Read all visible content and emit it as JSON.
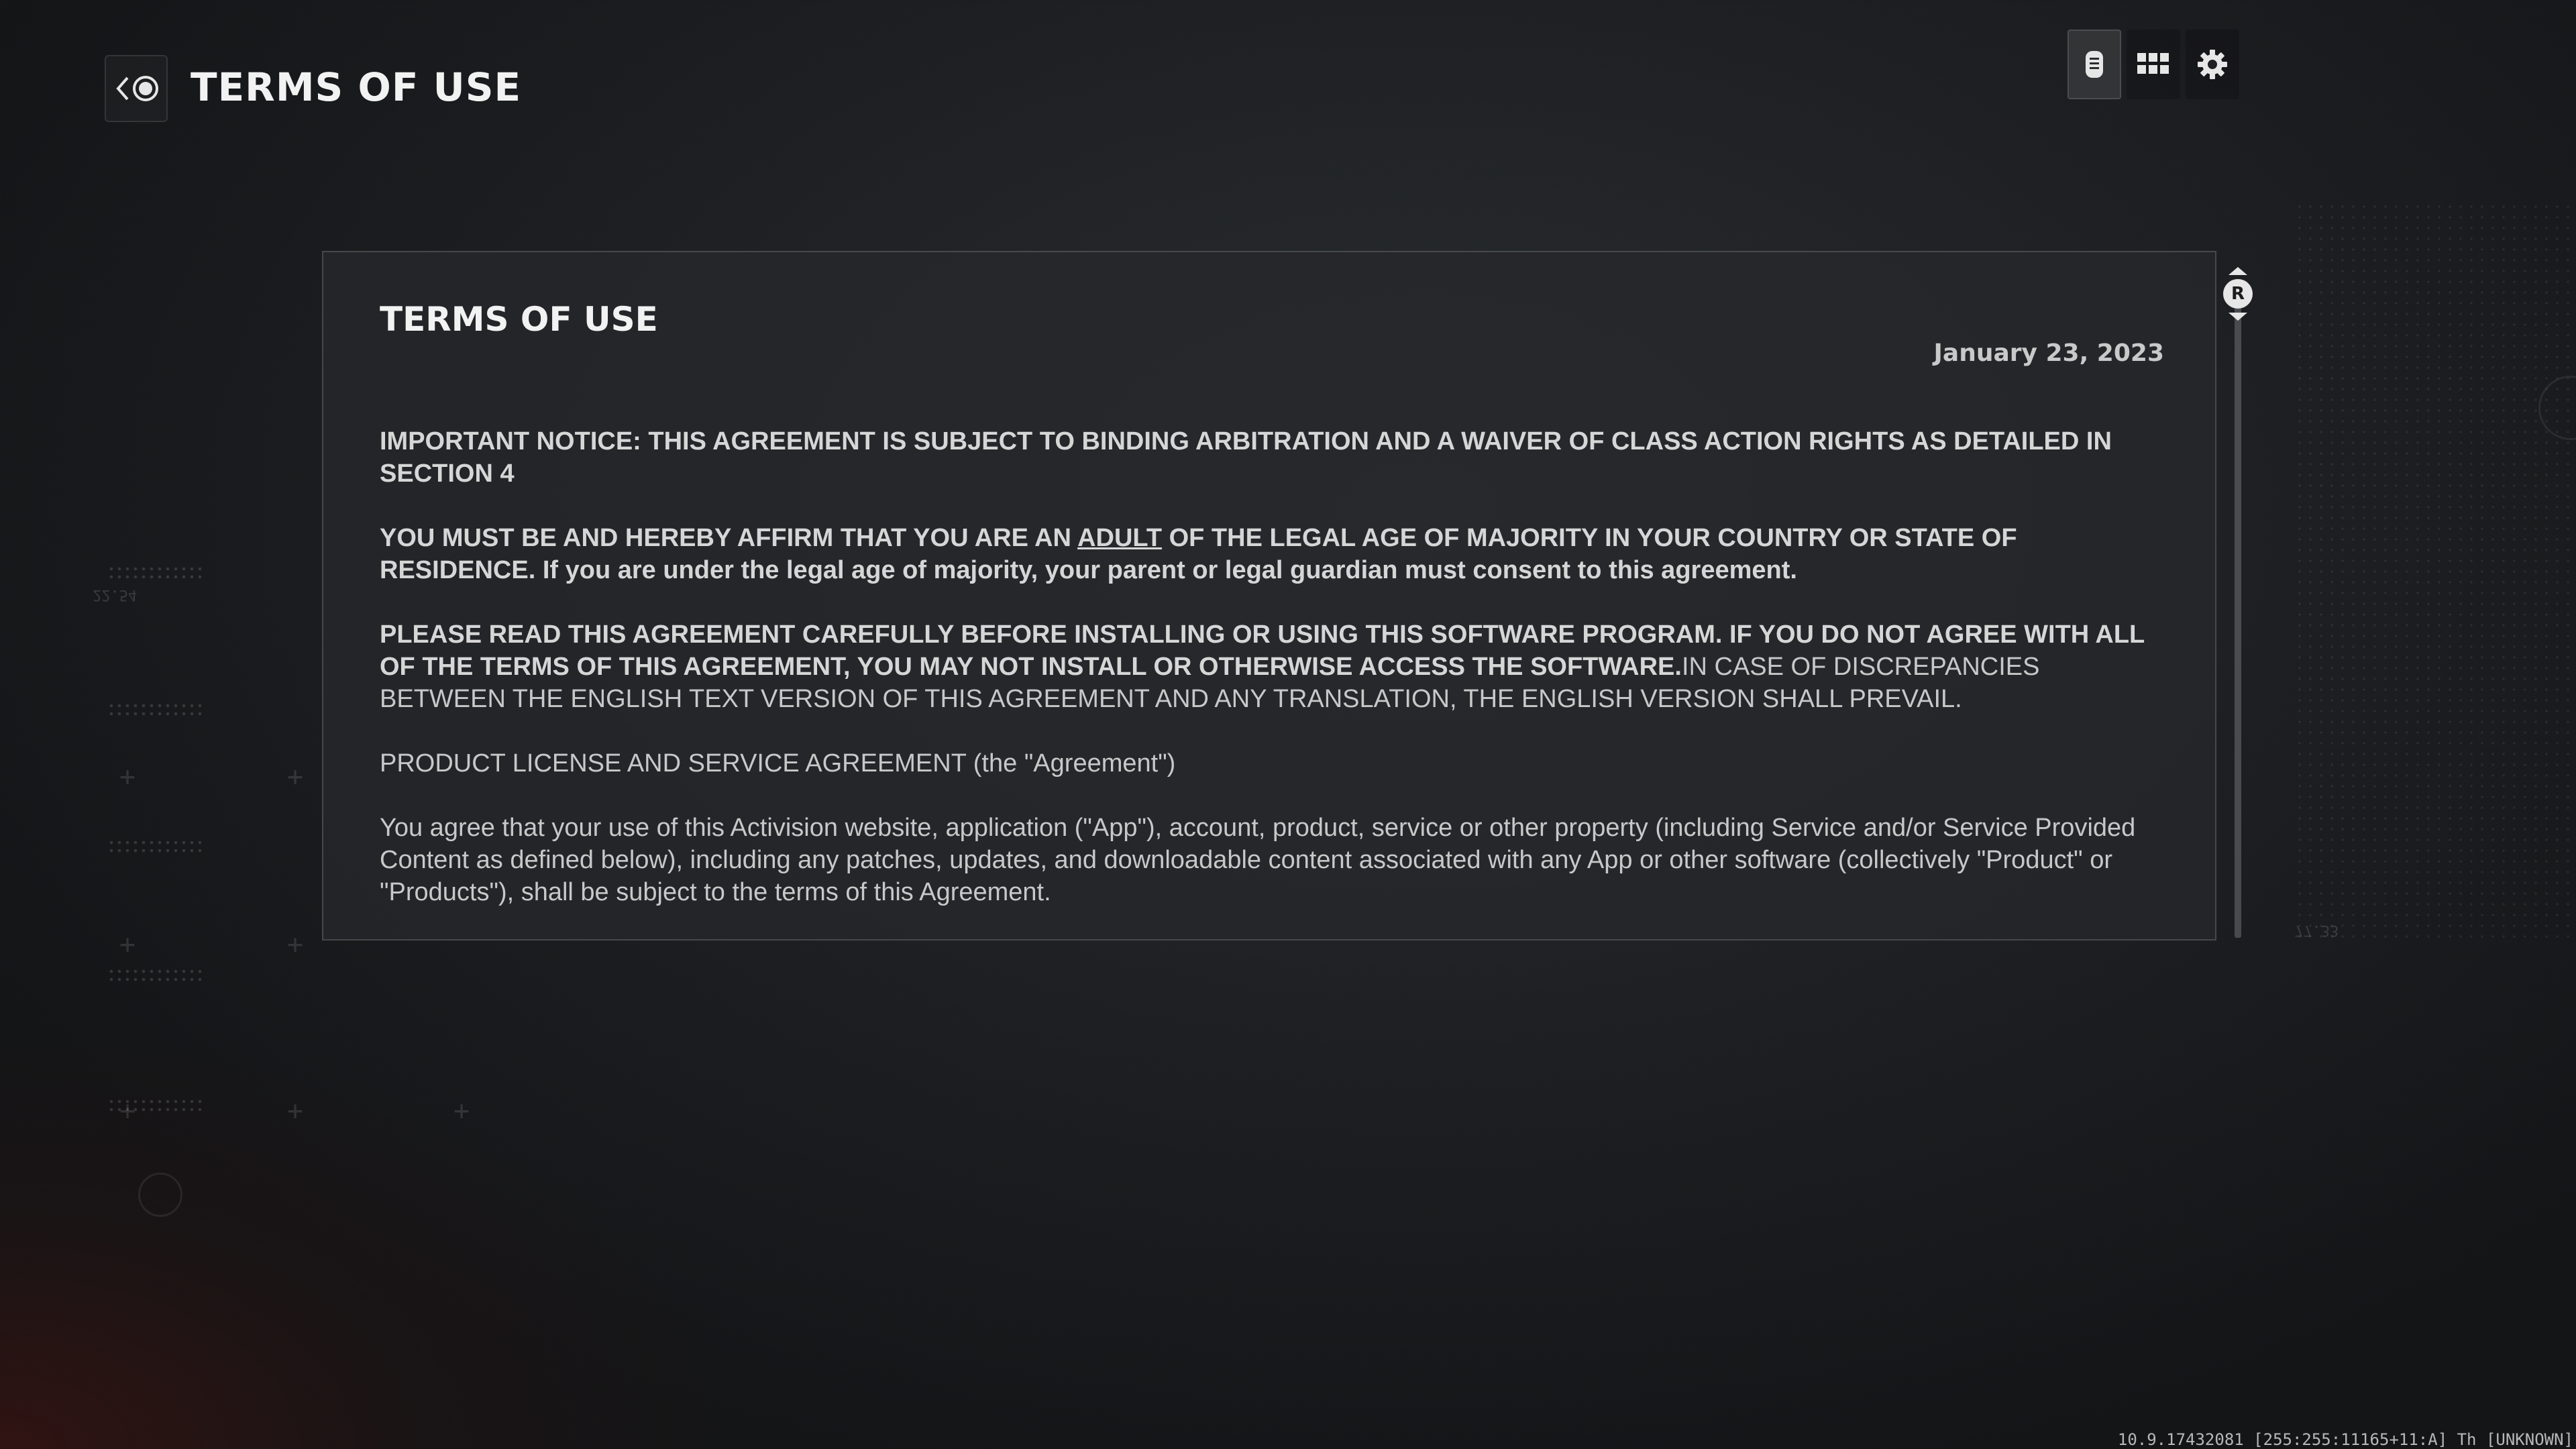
{
  "header": {
    "title": "TERMS OF USE",
    "back_icon": "back-chevron-icon",
    "controller_icon": "circle-button-icon"
  },
  "toolbar": {
    "items": [
      {
        "icon": "document-icon",
        "active": true
      },
      {
        "icon": "grid-icon",
        "active": false
      },
      {
        "icon": "gear-icon",
        "active": false
      }
    ]
  },
  "document": {
    "heading": "TERMS OF USE",
    "date": "January 23, 2023",
    "notice": "IMPORTANT NOTICE: THIS AGREEMENT IS SUBJECT TO BINDING ARBITRATION AND A WAIVER OF CLASS ACTION RIGHTS AS DETAILED IN SECTION 4",
    "age_part1": "YOU MUST BE AND HEREBY AFFIRM THAT YOU ARE AN ",
    "age_adult": "ADULT",
    "age_part2": " OF THE LEGAL AGE OF MAJORITY IN YOUR COUNTRY OR STATE OF RESIDENCE.  If you are under the legal age of majority, your parent or legal guardian must consent to this agreement.",
    "read_bold": "PLEASE READ THIS AGREEMENT CAREFULLY BEFORE INSTALLING OR USING THIS SOFTWARE PROGRAM.  IF YOU DO NOT AGREE WITH ALL OF THE TERMS OF THIS AGREEMENT, YOU MAY NOT INSTALL OR OTHERWISE ACCESS THE SOFTWARE.",
    "read_normal": "IN CASE OF DISCREPANCIES BETWEEN THE ENGLISH TEXT VERSION OF THIS AGREEMENT AND ANY TRANSLATION, THE ENGLISH VERSION SHALL PREVAIL.",
    "license_title": "PRODUCT LICENSE AND SERVICE AGREEMENT (the \"Agreement\")",
    "agree_text": "You agree that your use of this Activision website, application (\"App\"), account, product, service or other property (including Service and/or Service Provided Content as defined below), including any patches, updates, and downloadable content associated with any App or other software (collectively \"Product\" or \"Products\"), shall be subject to the terms of this Agreement."
  },
  "scrollbar": {
    "button_label": "R",
    "position": 0
  },
  "build": {
    "string": "10.9.17432081 [255:255:11165+11:A] Th [UNKNOWN]"
  },
  "decor": {
    "label_left": "22.54",
    "label_right": "77.33"
  }
}
